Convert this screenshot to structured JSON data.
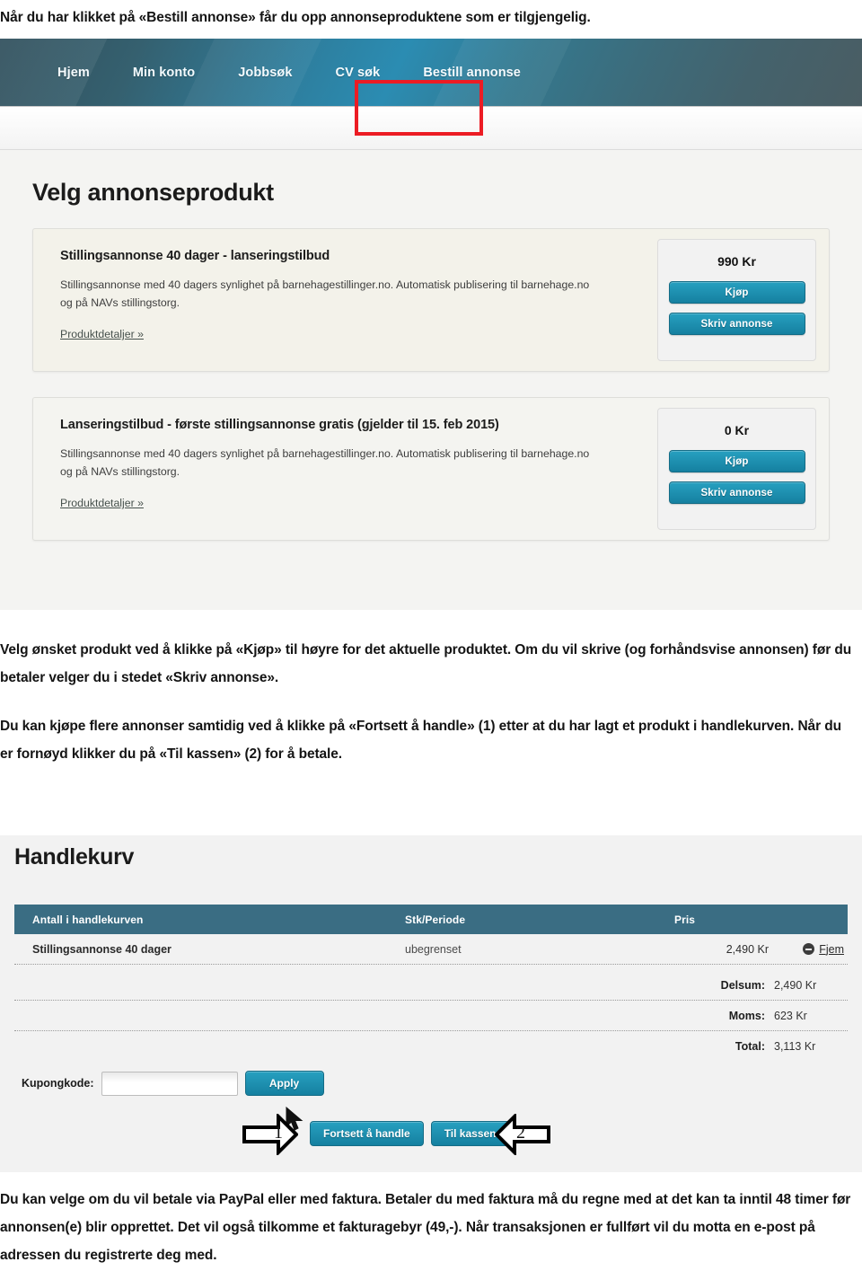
{
  "document": {
    "intro_paragraph": "Når du har klikket på «Bestill annonse» får du opp annonseproduktene som er tilgjengelig.",
    "paragraph_kjop": "Velg ønsket produkt ved å klikke på «Kjøp» til høyre for det aktuelle produktet. Om du vil skrive (og forhåndsvise annonsen) før du betaler velger du i stedet «Skriv annonse».",
    "paragraph_cart": "Du kan kjøpe flere annonser samtidig ved å klikke på «Fortsett å handle» (1) etter at du har lagt et produkt i handlekurven. Når du er fornøyd klikker du på «Til kassen» (2) for å betale.",
    "paragraph_payment": "Du kan velge om du vil betale via PayPal eller med faktura. Betaler du med faktura må du regne med at det kan ta inntil 48 timer før annonsen(e) blir opprettet. Det vil også tilkomme et fakturagebyr (49,-). Når transaksjonen er fullført vil du motta en e-post på adressen du registrerte deg med."
  },
  "product_screenshot": {
    "nav": {
      "items": [
        {
          "label": "Hjem",
          "active": false
        },
        {
          "label": "Min konto",
          "active": false
        },
        {
          "label": "Jobbsøk",
          "active": false
        },
        {
          "label": "CV søk",
          "active": false
        },
        {
          "label": "Bestill annonse",
          "active": true
        }
      ],
      "highlight_color": "#ec1c24"
    },
    "page_title": "Velg annonseprodukt",
    "products": [
      {
        "title": "Stillingsannonse 40 dager - lanseringstilbud",
        "description": "Stillingsannonse med 40 dagers synlighet på barnehagestillinger.no. Automatisk publisering til barnehage.no og på NAVs stillingstorg.",
        "details_link": "Produktdetaljer »",
        "price": "990 Kr",
        "buy_label": "Kjøp",
        "write_label": "Skriv annonse"
      },
      {
        "title": "Lanseringstilbud - første stillingsannonse gratis (gjelder til 15. feb 2015)",
        "description": "Stillingsannonse med 40 dagers synlighet på barnehagestillinger.no. Automatisk publisering til barnehage.no og på NAVs stillingstorg.",
        "details_link": "Produktdetaljer »",
        "price": "0 Kr",
        "buy_label": "Kjøp",
        "write_label": "Skriv annonse"
      }
    ],
    "accent_color": "#1580a0"
  },
  "cart_screenshot": {
    "title": "Handlekurv",
    "table": {
      "headers": [
        "Antall i handlekurven",
        "Stk/Periode",
        "Pris"
      ],
      "header_color": "#3a6d83",
      "rows": [
        {
          "name": "Stillingsannonse 40 dager",
          "quantity": "ubegrenset",
          "price": "2,490 Kr",
          "remove_label": "Fjem"
        }
      ]
    },
    "totals": [
      {
        "label": "Delsum:",
        "value": "2,490 Kr"
      },
      {
        "label": "Moms:",
        "value": "623 Kr"
      },
      {
        "label": "Total:",
        "value": "3,113 Kr"
      }
    ],
    "coupon": {
      "label": "Kupongkode:",
      "value": "",
      "placeholder": "",
      "apply_label": "Apply"
    },
    "actions": {
      "continue_label": "Fortsett å handle",
      "checkout_label": "Til kassen"
    },
    "annotations": [
      {
        "number": "1",
        "points_to": "Fortsett å handle"
      },
      {
        "number": "2",
        "points_to": "Til kassen"
      }
    ]
  }
}
